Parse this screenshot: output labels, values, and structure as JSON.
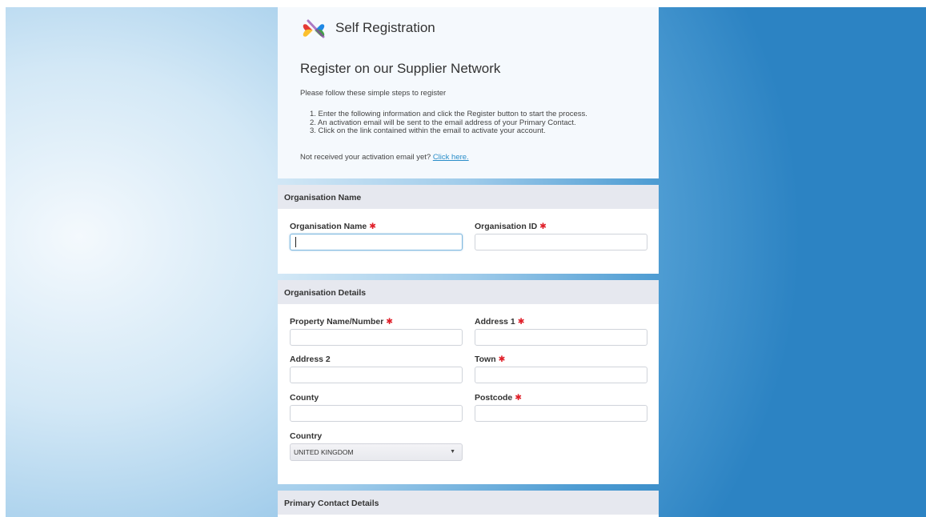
{
  "header": {
    "logo_title": "Self Registration",
    "heading": "Register on our Supplier Network",
    "intro": "Please follow these simple steps to register",
    "steps": [
      "1.  Enter the following information and click the Register button to start the process.",
      "2.  An activation email will be sent to the email address of your Primary Contact.",
      "3.  Click on the link contained within the email to activate your account."
    ],
    "not_received": "Not received your activation email yet?",
    "click_here": "Click here."
  },
  "org_name_section": {
    "title": "Organisation Name",
    "org_name_label": "Organisation Name",
    "org_name_value": "",
    "org_id_label": "Organisation ID",
    "org_id_value": ""
  },
  "org_details_section": {
    "title": "Organisation Details",
    "property_label": "Property Name/Number",
    "address1_label": "Address 1",
    "address2_label": "Address 2",
    "town_label": "Town",
    "county_label": "County",
    "postcode_label": "Postcode",
    "country_label": "Country",
    "country_value": "UNITED KINGDOM"
  },
  "primary_contact_section": {
    "title": "Primary Contact Details"
  },
  "required_marker": "✱",
  "colors": {
    "required": "#e0202a",
    "link": "#2a8ec9",
    "section_header_bg": "#e6e8ef",
    "focus_border": "#7fb8df"
  }
}
